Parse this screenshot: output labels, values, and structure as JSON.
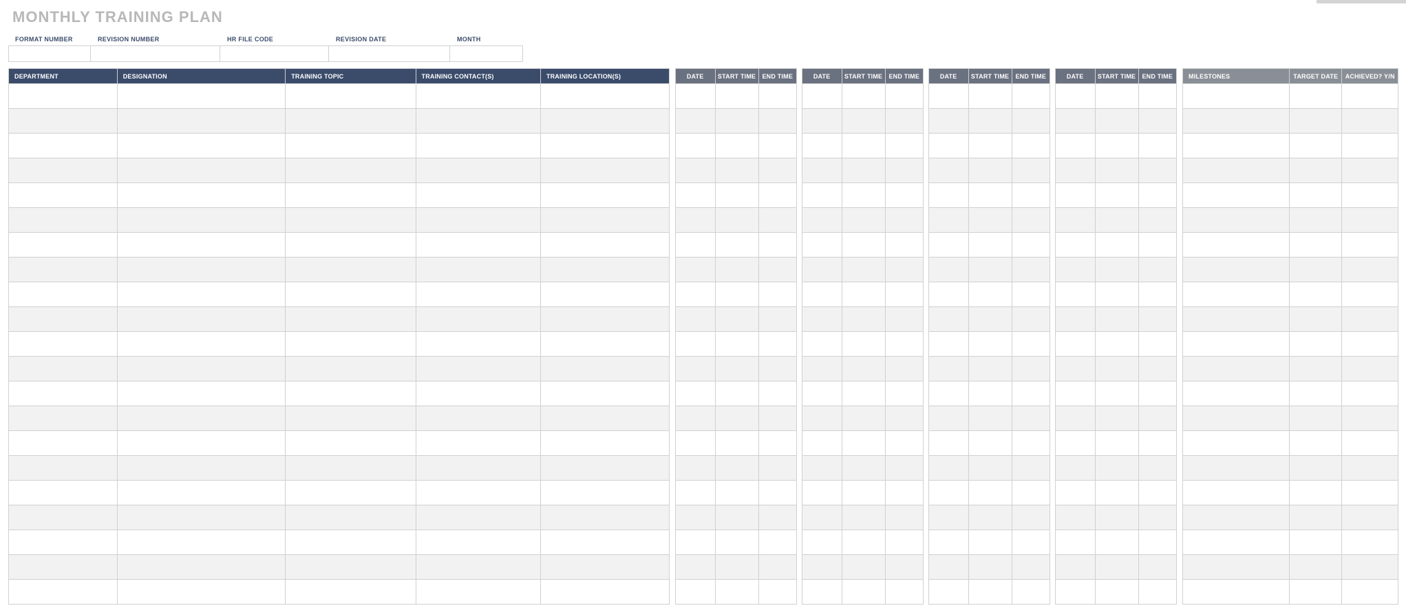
{
  "title": "MONTHLY TRAINING PLAN",
  "meta_labels": {
    "format_number": "FORMAT NUMBER",
    "revision_number": "REVISION NUMBER",
    "hr_file_code": "HR FILE CODE",
    "revision_date": "REVISION DATE",
    "month": "MONTH"
  },
  "meta_values": {
    "format_number": "",
    "revision_number": "",
    "hr_file_code": "",
    "revision_date": "",
    "month": ""
  },
  "columns": {
    "department": "DEPARTMENT",
    "designation": "DESIGNATION",
    "training_topic": "TRAINING TOPIC",
    "training_contacts": "TRAINING CONTACT(S)",
    "training_locations": "TRAINING LOCATION(S)",
    "date": "DATE",
    "start_time": "START TIME",
    "end_time": "END TIME",
    "milestones": "MILESTONES",
    "target_date": "TARGET DATE",
    "achieved": "ACHIEVED? Y/N"
  },
  "week_groups": 4,
  "row_count": 21,
  "rows": [
    {
      "department": "",
      "designation": "",
      "training_topic": "",
      "training_contacts": "",
      "training_locations": "",
      "w1_date": "",
      "w1_start": "",
      "w1_end": "",
      "w2_date": "",
      "w2_start": "",
      "w2_end": "",
      "w3_date": "",
      "w3_start": "",
      "w3_end": "",
      "w4_date": "",
      "w4_start": "",
      "w4_end": "",
      "milestones": "",
      "target_date": "",
      "achieved": ""
    },
    {
      "department": "",
      "designation": "",
      "training_topic": "",
      "training_contacts": "",
      "training_locations": "",
      "w1_date": "",
      "w1_start": "",
      "w1_end": "",
      "w2_date": "",
      "w2_start": "",
      "w2_end": "",
      "w3_date": "",
      "w3_start": "",
      "w3_end": "",
      "w4_date": "",
      "w4_start": "",
      "w4_end": "",
      "milestones": "",
      "target_date": "",
      "achieved": ""
    },
    {
      "department": "",
      "designation": "",
      "training_topic": "",
      "training_contacts": "",
      "training_locations": "",
      "w1_date": "",
      "w1_start": "",
      "w1_end": "",
      "w2_date": "",
      "w2_start": "",
      "w2_end": "",
      "w3_date": "",
      "w3_start": "",
      "w3_end": "",
      "w4_date": "",
      "w4_start": "",
      "w4_end": "",
      "milestones": "",
      "target_date": "",
      "achieved": ""
    },
    {
      "department": "",
      "designation": "",
      "training_topic": "",
      "training_contacts": "",
      "training_locations": "",
      "w1_date": "",
      "w1_start": "",
      "w1_end": "",
      "w2_date": "",
      "w2_start": "",
      "w2_end": "",
      "w3_date": "",
      "w3_start": "",
      "w3_end": "",
      "w4_date": "",
      "w4_start": "",
      "w4_end": "",
      "milestones": "",
      "target_date": "",
      "achieved": ""
    },
    {
      "department": "",
      "designation": "",
      "training_topic": "",
      "training_contacts": "",
      "training_locations": "",
      "w1_date": "",
      "w1_start": "",
      "w1_end": "",
      "w2_date": "",
      "w2_start": "",
      "w2_end": "",
      "w3_date": "",
      "w3_start": "",
      "w3_end": "",
      "w4_date": "",
      "w4_start": "",
      "w4_end": "",
      "milestones": "",
      "target_date": "",
      "achieved": ""
    },
    {
      "department": "",
      "designation": "",
      "training_topic": "",
      "training_contacts": "",
      "training_locations": "",
      "w1_date": "",
      "w1_start": "",
      "w1_end": "",
      "w2_date": "",
      "w2_start": "",
      "w2_end": "",
      "w3_date": "",
      "w3_start": "",
      "w3_end": "",
      "w4_date": "",
      "w4_start": "",
      "w4_end": "",
      "milestones": "",
      "target_date": "",
      "achieved": ""
    },
    {
      "department": "",
      "designation": "",
      "training_topic": "",
      "training_contacts": "",
      "training_locations": "",
      "w1_date": "",
      "w1_start": "",
      "w1_end": "",
      "w2_date": "",
      "w2_start": "",
      "w2_end": "",
      "w3_date": "",
      "w3_start": "",
      "w3_end": "",
      "w4_date": "",
      "w4_start": "",
      "w4_end": "",
      "milestones": "",
      "target_date": "",
      "achieved": ""
    },
    {
      "department": "",
      "designation": "",
      "training_topic": "",
      "training_contacts": "",
      "training_locations": "",
      "w1_date": "",
      "w1_start": "",
      "w1_end": "",
      "w2_date": "",
      "w2_start": "",
      "w2_end": "",
      "w3_date": "",
      "w3_start": "",
      "w3_end": "",
      "w4_date": "",
      "w4_start": "",
      "w4_end": "",
      "milestones": "",
      "target_date": "",
      "achieved": ""
    },
    {
      "department": "",
      "designation": "",
      "training_topic": "",
      "training_contacts": "",
      "training_locations": "",
      "w1_date": "",
      "w1_start": "",
      "w1_end": "",
      "w2_date": "",
      "w2_start": "",
      "w2_end": "",
      "w3_date": "",
      "w3_start": "",
      "w3_end": "",
      "w4_date": "",
      "w4_start": "",
      "w4_end": "",
      "milestones": "",
      "target_date": "",
      "achieved": ""
    },
    {
      "department": "",
      "designation": "",
      "training_topic": "",
      "training_contacts": "",
      "training_locations": "",
      "w1_date": "",
      "w1_start": "",
      "w1_end": "",
      "w2_date": "",
      "w2_start": "",
      "w2_end": "",
      "w3_date": "",
      "w3_start": "",
      "w3_end": "",
      "w4_date": "",
      "w4_start": "",
      "w4_end": "",
      "milestones": "",
      "target_date": "",
      "achieved": ""
    },
    {
      "department": "",
      "designation": "",
      "training_topic": "",
      "training_contacts": "",
      "training_locations": "",
      "w1_date": "",
      "w1_start": "",
      "w1_end": "",
      "w2_date": "",
      "w2_start": "",
      "w2_end": "",
      "w3_date": "",
      "w3_start": "",
      "w3_end": "",
      "w4_date": "",
      "w4_start": "",
      "w4_end": "",
      "milestones": "",
      "target_date": "",
      "achieved": ""
    },
    {
      "department": "",
      "designation": "",
      "training_topic": "",
      "training_contacts": "",
      "training_locations": "",
      "w1_date": "",
      "w1_start": "",
      "w1_end": "",
      "w2_date": "",
      "w2_start": "",
      "w2_end": "",
      "w3_date": "",
      "w3_start": "",
      "w3_end": "",
      "w4_date": "",
      "w4_start": "",
      "w4_end": "",
      "milestones": "",
      "target_date": "",
      "achieved": ""
    },
    {
      "department": "",
      "designation": "",
      "training_topic": "",
      "training_contacts": "",
      "training_locations": "",
      "w1_date": "",
      "w1_start": "",
      "w1_end": "",
      "w2_date": "",
      "w2_start": "",
      "w2_end": "",
      "w3_date": "",
      "w3_start": "",
      "w3_end": "",
      "w4_date": "",
      "w4_start": "",
      "w4_end": "",
      "milestones": "",
      "target_date": "",
      "achieved": ""
    },
    {
      "department": "",
      "designation": "",
      "training_topic": "",
      "training_contacts": "",
      "training_locations": "",
      "w1_date": "",
      "w1_start": "",
      "w1_end": "",
      "w2_date": "",
      "w2_start": "",
      "w2_end": "",
      "w3_date": "",
      "w3_start": "",
      "w3_end": "",
      "w4_date": "",
      "w4_start": "",
      "w4_end": "",
      "milestones": "",
      "target_date": "",
      "achieved": ""
    },
    {
      "department": "",
      "designation": "",
      "training_topic": "",
      "training_contacts": "",
      "training_locations": "",
      "w1_date": "",
      "w1_start": "",
      "w1_end": "",
      "w2_date": "",
      "w2_start": "",
      "w2_end": "",
      "w3_date": "",
      "w3_start": "",
      "w3_end": "",
      "w4_date": "",
      "w4_start": "",
      "w4_end": "",
      "milestones": "",
      "target_date": "",
      "achieved": ""
    },
    {
      "department": "",
      "designation": "",
      "training_topic": "",
      "training_contacts": "",
      "training_locations": "",
      "w1_date": "",
      "w1_start": "",
      "w1_end": "",
      "w2_date": "",
      "w2_start": "",
      "w2_end": "",
      "w3_date": "",
      "w3_start": "",
      "w3_end": "",
      "w4_date": "",
      "w4_start": "",
      "w4_end": "",
      "milestones": "",
      "target_date": "",
      "achieved": ""
    },
    {
      "department": "",
      "designation": "",
      "training_topic": "",
      "training_contacts": "",
      "training_locations": "",
      "w1_date": "",
      "w1_start": "",
      "w1_end": "",
      "w2_date": "",
      "w2_start": "",
      "w2_end": "",
      "w3_date": "",
      "w3_start": "",
      "w3_end": "",
      "w4_date": "",
      "w4_start": "",
      "w4_end": "",
      "milestones": "",
      "target_date": "",
      "achieved": ""
    },
    {
      "department": "",
      "designation": "",
      "training_topic": "",
      "training_contacts": "",
      "training_locations": "",
      "w1_date": "",
      "w1_start": "",
      "w1_end": "",
      "w2_date": "",
      "w2_start": "",
      "w2_end": "",
      "w3_date": "",
      "w3_start": "",
      "w3_end": "",
      "w4_date": "",
      "w4_start": "",
      "w4_end": "",
      "milestones": "",
      "target_date": "",
      "achieved": ""
    },
    {
      "department": "",
      "designation": "",
      "training_topic": "",
      "training_contacts": "",
      "training_locations": "",
      "w1_date": "",
      "w1_start": "",
      "w1_end": "",
      "w2_date": "",
      "w2_start": "",
      "w2_end": "",
      "w3_date": "",
      "w3_start": "",
      "w3_end": "",
      "w4_date": "",
      "w4_start": "",
      "w4_end": "",
      "milestones": "",
      "target_date": "",
      "achieved": ""
    },
    {
      "department": "",
      "designation": "",
      "training_topic": "",
      "training_contacts": "",
      "training_locations": "",
      "w1_date": "",
      "w1_start": "",
      "w1_end": "",
      "w2_date": "",
      "w2_start": "",
      "w2_end": "",
      "w3_date": "",
      "w3_start": "",
      "w3_end": "",
      "w4_date": "",
      "w4_start": "",
      "w4_end": "",
      "milestones": "",
      "target_date": "",
      "achieved": ""
    },
    {
      "department": "",
      "designation": "",
      "training_topic": "",
      "training_contacts": "",
      "training_locations": "",
      "w1_date": "",
      "w1_start": "",
      "w1_end": "",
      "w2_date": "",
      "w2_start": "",
      "w2_end": "",
      "w3_date": "",
      "w3_start": "",
      "w3_end": "",
      "w4_date": "",
      "w4_start": "",
      "w4_end": "",
      "milestones": "",
      "target_date": "",
      "achieved": ""
    }
  ]
}
